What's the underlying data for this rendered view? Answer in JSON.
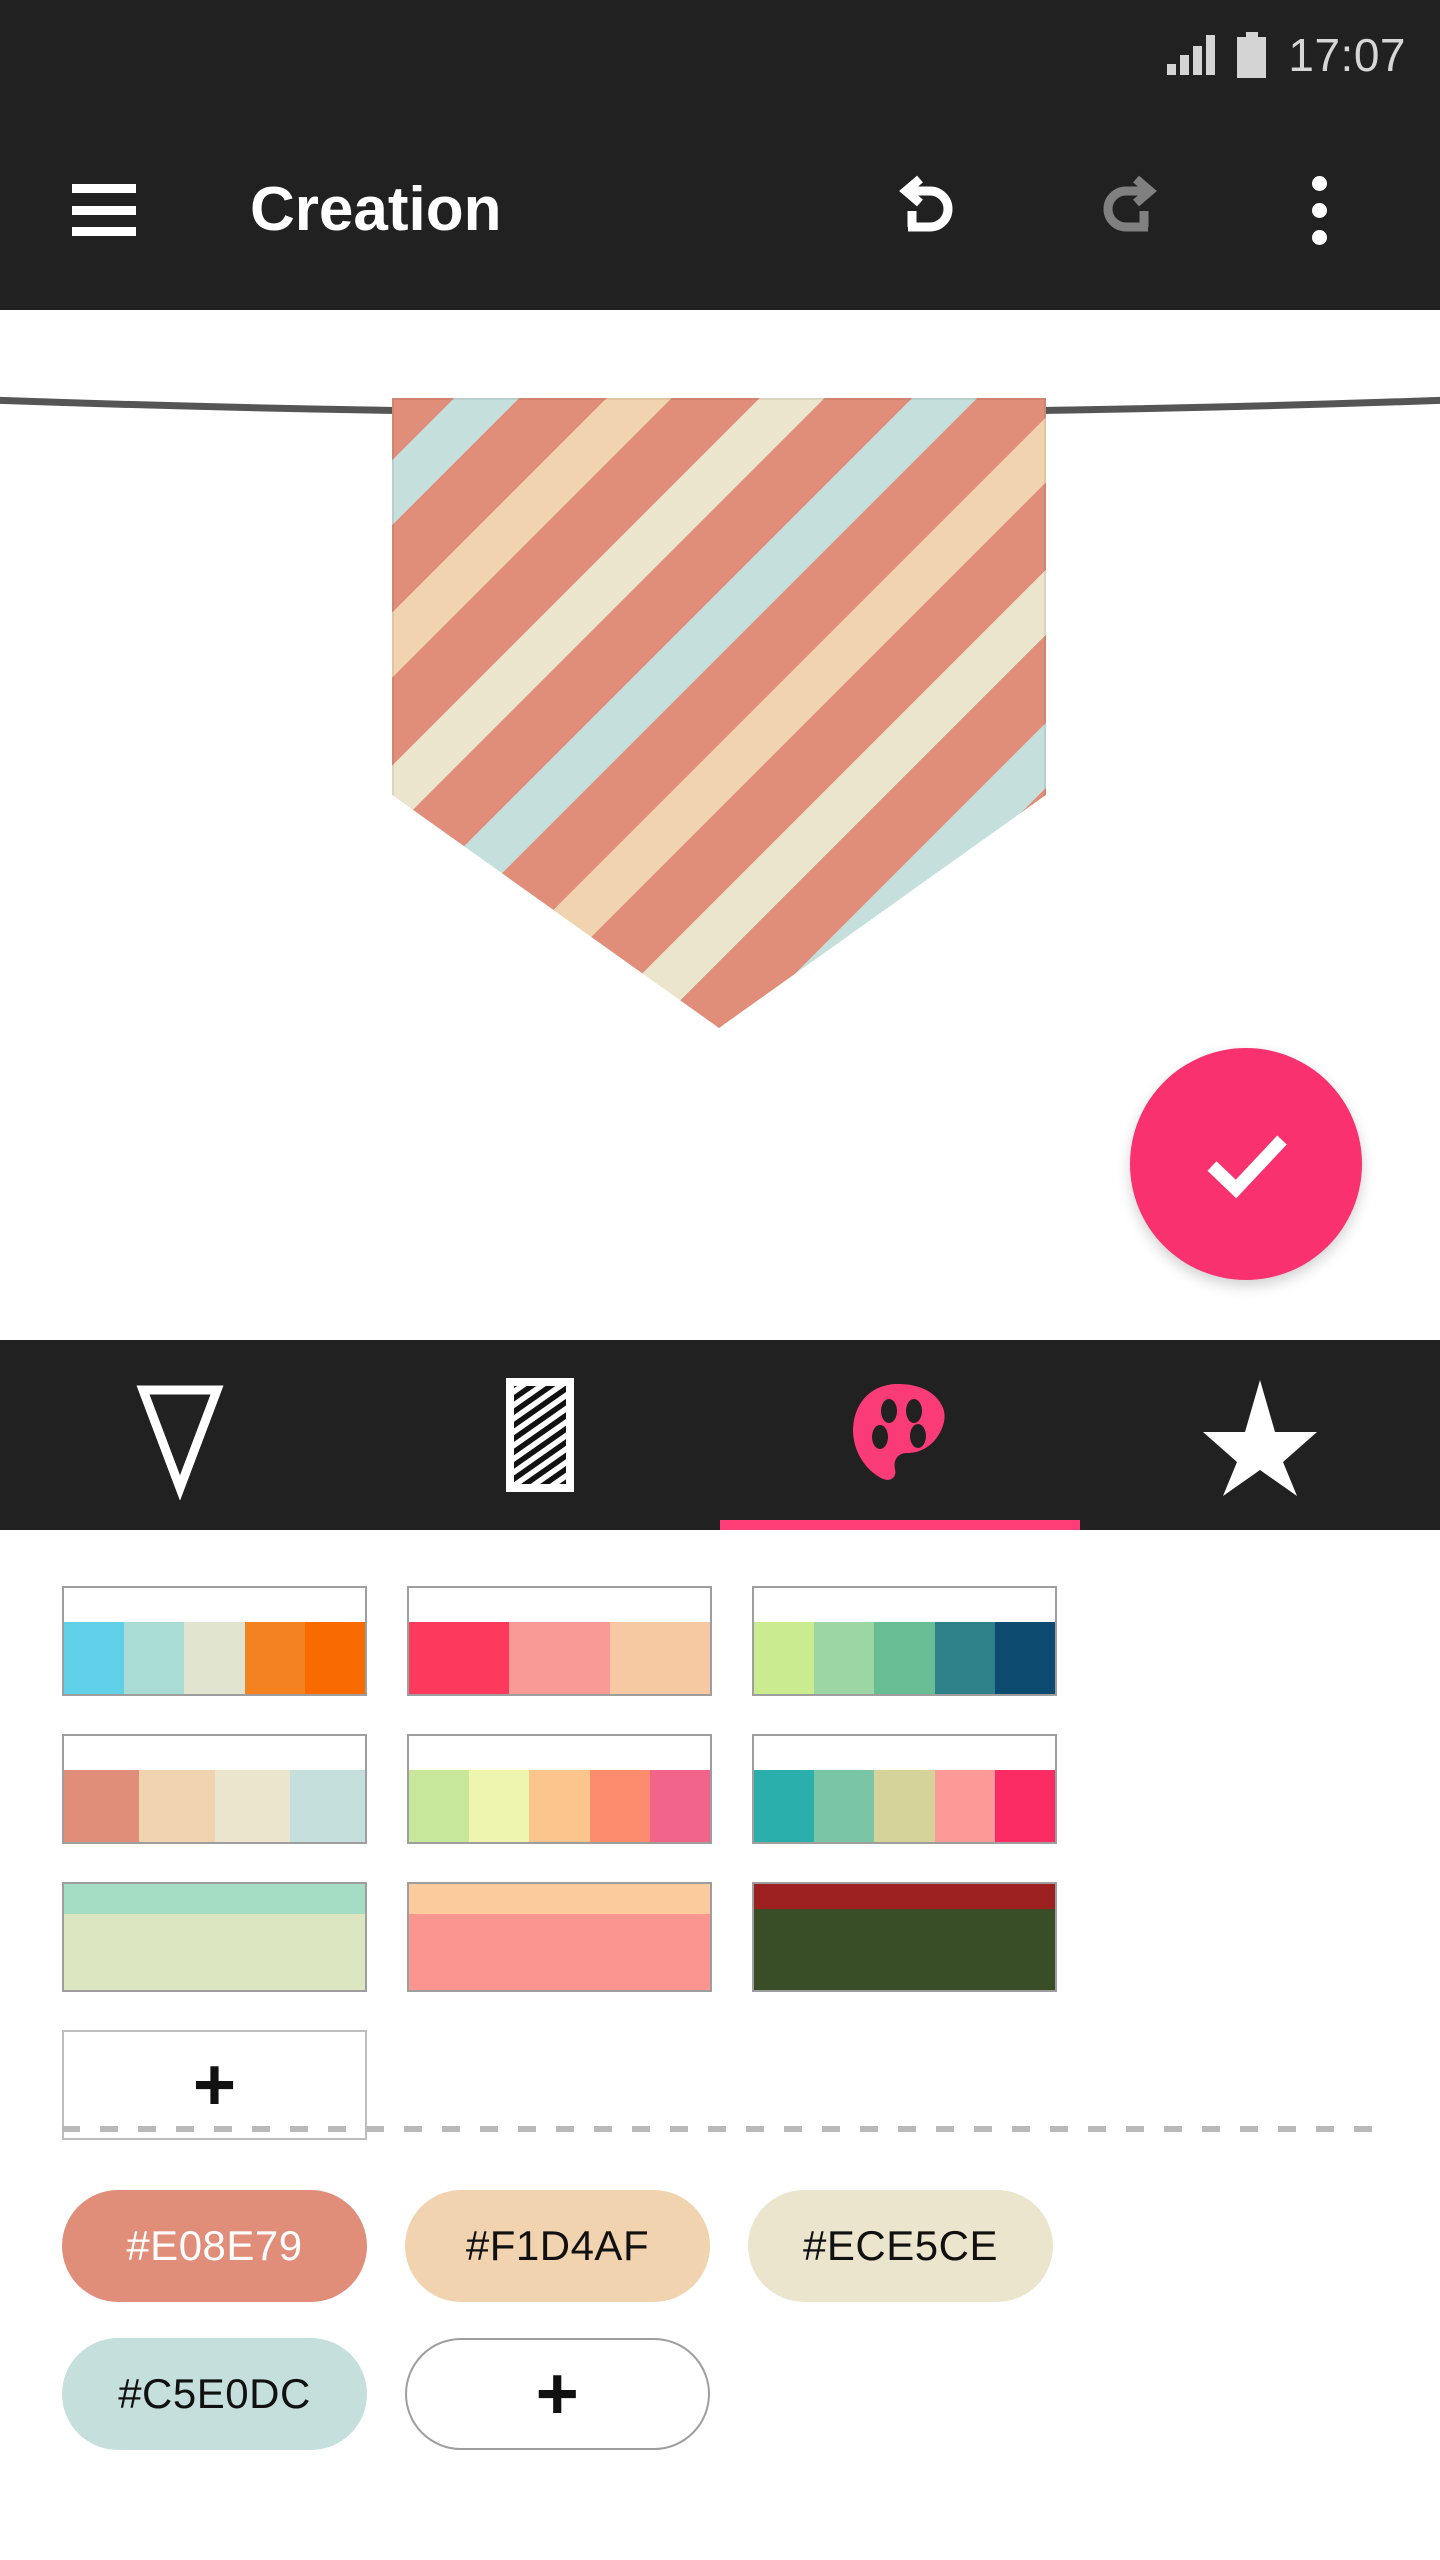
{
  "status_bar": {
    "time": "17:07",
    "signal_icon": "signal-bars-icon",
    "battery_icon": "battery-full-icon"
  },
  "app_bar": {
    "menu_icon": "hamburger-menu-icon",
    "title": "Creation",
    "undo_icon": "undo-icon",
    "redo_icon": "redo-icon",
    "overflow_icon": "more-vertical-icon",
    "background": "#212121"
  },
  "canvas": {
    "string_color": "#555555",
    "pennant": {
      "shape": "pennant-banner",
      "stripe_colors": [
        "#E08E79",
        "#F1D4AF",
        "#E08E79",
        "#C5E0DC",
        "#E08E79",
        "#ECE5CE"
      ],
      "stripe_angle_deg": -45
    },
    "fab": {
      "icon": "check-icon",
      "color": "#F9316F",
      "label": "Done"
    }
  },
  "tabs": {
    "active_index": 2,
    "indicator_color": "#FF3D77",
    "items": [
      {
        "icon": "pennant-shape-icon",
        "label": "Shape"
      },
      {
        "icon": "stripe-pattern-icon",
        "label": "Pattern"
      },
      {
        "icon": "palette-icon",
        "label": "Colors"
      },
      {
        "icon": "star-icon",
        "label": "Favorites"
      }
    ]
  },
  "palettes": {
    "add_label": "+",
    "items": [
      {
        "name": "palette-1",
        "layout": "columns",
        "colors": [
          "#5FD0E8",
          "#A9DCD5",
          "#E1E4CF",
          "#F58220",
          "#F96A00"
        ]
      },
      {
        "name": "palette-2",
        "layout": "columns",
        "colors": [
          "#FB3A5D",
          "#F99A96",
          "#F7C9A3",
          "#FFFFFF",
          "#FFFFFF"
        ]
      },
      {
        "name": "palette-3",
        "layout": "columns",
        "colors": [
          "#CBEC8E",
          "#9BD6A4",
          "#68BD95",
          "#2E8189",
          "#0D4A70"
        ]
      },
      {
        "name": "palette-4",
        "layout": "columns",
        "colors": [
          "#E08E79",
          "#F1D4AF",
          "#ECE5CE",
          "#C5E0DC",
          "#FFFFFF"
        ]
      },
      {
        "name": "palette-5",
        "layout": "columns",
        "colors": [
          "#C7E89A",
          "#EDF5AE",
          "#FCC58D",
          "#FB8C6E",
          "#F3648B"
        ]
      },
      {
        "name": "palette-6",
        "layout": "columns",
        "colors": [
          "#2BAFAC",
          "#79C5A6",
          "#D5D399",
          "#FB9A96",
          "#FB2B63"
        ]
      },
      {
        "name": "palette-7",
        "layout": "rows",
        "colors": [
          "#A5DCC4",
          "#DCE6C0"
        ]
      },
      {
        "name": "palette-8",
        "layout": "rows",
        "colors": [
          "#FBCB9D",
          "#FA9590"
        ]
      },
      {
        "name": "palette-9",
        "layout": "rows",
        "colors": [
          "#9E2121",
          "#394E26"
        ]
      }
    ]
  },
  "colors": {
    "add_label": "+",
    "chips": [
      {
        "hex": "#E08E79",
        "text_color": "#FFFFFF"
      },
      {
        "hex": "#F1D4AF",
        "text_color": "#111111"
      },
      {
        "hex": "#ECE5CE",
        "text_color": "#111111"
      },
      {
        "hex": "#C5E0DC",
        "text_color": "#111111"
      }
    ]
  }
}
